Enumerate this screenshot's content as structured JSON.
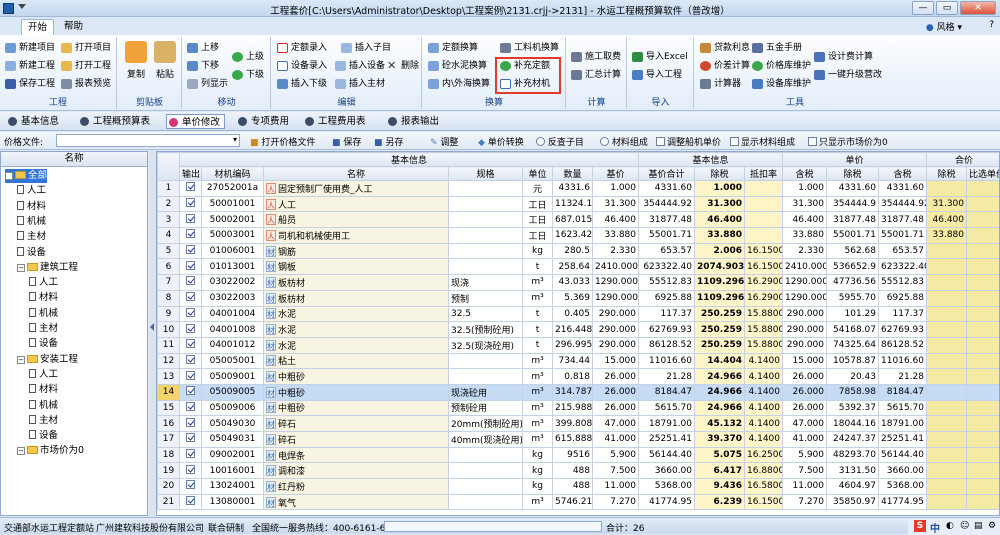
{
  "window": {
    "title": "工程套价[C:\\Users\\Administrator\\Desktop\\工程案例\\2131.crjj->2131] - 水运工程概预算软件（普改增）",
    "min": "—",
    "max": "▭",
    "close": "✕"
  },
  "tabs": [
    "开始",
    "帮助"
  ],
  "skin_label": "风格",
  "ribbon": {
    "groups": [
      {
        "label": "工程",
        "buttons": [
          "新建项目",
          "打开项目",
          "新建工程",
          "打开工程",
          "保存工程",
          "报表预览"
        ]
      },
      {
        "label": "剪贴板",
        "buttons": [
          "复制",
          "粘贴"
        ]
      },
      {
        "label": "移动",
        "buttons": [
          "上移",
          "下移",
          "列显示",
          "上级",
          "下级"
        ]
      },
      {
        "label": "编辑",
        "buttons": [
          "定额录入",
          "插入子目",
          "设备录入",
          "插入设备",
          "删除",
          "插入下级",
          "插入主材"
        ]
      },
      {
        "label": "换算",
        "buttons": [
          "定额换算",
          "工料机换算",
          "砼水泥换算",
          "补充定额",
          "内\\外海换算",
          "补充材机"
        ]
      },
      {
        "label": "计算",
        "buttons": [
          "施工取费",
          "汇总计算"
        ]
      },
      {
        "label": "导入",
        "buttons": [
          "导入Excel",
          "导入工程"
        ]
      },
      {
        "label": "工具",
        "buttons": [
          "贷款利息",
          "五金手册",
          "设计费计算",
          "价差计算",
          "价格库维护",
          "一键升级营改",
          "计算器",
          "设备库维护"
        ]
      }
    ]
  },
  "secondary_tabs": [
    "基本信息",
    "工程概预算表",
    "单价修改",
    "专项费用",
    "工程费用表",
    "报表输出"
  ],
  "toolbar": {
    "price_file_label": "价格文件:",
    "open_price": "打开价格文件",
    "save": "保存",
    "save_as": "另存",
    "adjust": "调整",
    "price_convert": "单价转换",
    "reverse_check": "反查子目",
    "material_comp": "材料组成",
    "adjust_ship": "调整船机单价",
    "show_material": "显示材料组成",
    "show_market": "只显示市场价为0"
  },
  "tree": {
    "header": "名称",
    "nodes": [
      {
        "label": "全部",
        "level": 0,
        "type": "folder",
        "selected": true
      },
      {
        "label": "人工",
        "level": 1,
        "type": "doc"
      },
      {
        "label": "材料",
        "level": 1,
        "type": "doc"
      },
      {
        "label": "机械",
        "level": 1,
        "type": "doc"
      },
      {
        "label": "主材",
        "level": 1,
        "type": "doc"
      },
      {
        "label": "设备",
        "level": 1,
        "type": "doc"
      },
      {
        "label": "建筑工程",
        "level": 1,
        "type": "folder"
      },
      {
        "label": "人工",
        "level": 2,
        "type": "doc"
      },
      {
        "label": "材料",
        "level": 2,
        "type": "doc"
      },
      {
        "label": "机械",
        "level": 2,
        "type": "doc"
      },
      {
        "label": "主材",
        "level": 2,
        "type": "doc"
      },
      {
        "label": "设备",
        "level": 2,
        "type": "doc"
      },
      {
        "label": "安装工程",
        "level": 1,
        "type": "folder"
      },
      {
        "label": "人工",
        "level": 2,
        "type": "doc"
      },
      {
        "label": "材料",
        "level": 2,
        "type": "doc"
      },
      {
        "label": "机械",
        "level": 2,
        "type": "doc"
      },
      {
        "label": "主材",
        "level": 2,
        "type": "doc"
      },
      {
        "label": "设备",
        "level": 2,
        "type": "doc"
      },
      {
        "label": "市场价为0",
        "level": 1,
        "type": "folder"
      }
    ]
  },
  "grid": {
    "group_headers": {
      "base": "基本信息",
      "unit_price": "单价",
      "total": "合价",
      "compare": "比选单价"
    },
    "columns": [
      "输出",
      "材机编码",
      "名称",
      "规格",
      "单位",
      "数量",
      "基价",
      "基价合计",
      "除税",
      "抵扣率",
      "含税",
      "除税",
      "含税",
      "除税"
    ],
    "rows": [
      {
        "n": "1",
        "code": "27052001a",
        "tag": "人",
        "name": "固定预制厂使用费_人工",
        "spec": "",
        "unit": "元",
        "qty": "4331.6",
        "base": "1.000",
        "base_total": "4331.60",
        "ex": "1.000",
        "rate": "",
        "inc": "1.000",
        "t_ex": "4331.60",
        "t_inc": "4331.60",
        "cmp": ""
      },
      {
        "n": "2",
        "code": "50001001",
        "tag": "人",
        "name": "人工",
        "spec": "",
        "unit": "工日",
        "qty": "11324.11",
        "base": "31.300",
        "base_total": "354444.92",
        "ex": "31.300",
        "rate": "",
        "inc": "31.300",
        "t_ex": "354444.9",
        "t_inc": "354444.92",
        "cmp": "31.300"
      },
      {
        "n": "3",
        "code": "50002001",
        "tag": "人",
        "name": "船员",
        "spec": "",
        "unit": "工日",
        "qty": "687.015",
        "base": "46.400",
        "base_total": "31877.48",
        "ex": "46.400",
        "rate": "",
        "inc": "46.400",
        "t_ex": "31877.48",
        "t_inc": "31877.48",
        "cmp": "46.400"
      },
      {
        "n": "4",
        "code": "50003001",
        "tag": "人",
        "name": "司机和机械使用工",
        "spec": "",
        "unit": "工日",
        "qty": "1623.427",
        "base": "33.880",
        "base_total": "55001.71",
        "ex": "33.880",
        "rate": "",
        "inc": "33.880",
        "t_ex": "55001.71",
        "t_inc": "55001.71",
        "cmp": "33.880"
      },
      {
        "n": "5",
        "code": "01006001",
        "tag": "材",
        "name": "钢筋",
        "spec": "",
        "unit": "kg",
        "qty": "280.5",
        "base": "2.330",
        "base_total": "653.57",
        "ex": "2.006",
        "rate": "16.1500",
        "inc": "2.330",
        "t_ex": "562.68",
        "t_inc": "653.57",
        "cmp": ""
      },
      {
        "n": "6",
        "code": "01013001",
        "tag": "材",
        "name": "钢板",
        "spec": "",
        "unit": "t",
        "qty": "258.64",
        "base": "2410.000",
        "base_total": "623322.40",
        "ex": "2074.903",
        "rate": "16.1500",
        "inc": "2410.000",
        "t_ex": "536652.9",
        "t_inc": "623322.40",
        "cmp": ""
      },
      {
        "n": "7",
        "code": "03022002",
        "tag": "材",
        "name": "板枋材",
        "spec": "现浇",
        "unit": "m³",
        "qty": "43.033",
        "base": "1290.000",
        "base_total": "55512.83",
        "ex": "1109.296",
        "rate": "16.2900",
        "inc": "1290.000",
        "t_ex": "47736.56",
        "t_inc": "55512.83",
        "cmp": ""
      },
      {
        "n": "8",
        "code": "03022003",
        "tag": "材",
        "name": "板枋材",
        "spec": "预制",
        "unit": "m³",
        "qty": "5.369",
        "base": "1290.000",
        "base_total": "6925.88",
        "ex": "1109.296",
        "rate": "16.2900",
        "inc": "1290.000",
        "t_ex": "5955.70",
        "t_inc": "6925.88",
        "cmp": ""
      },
      {
        "n": "9",
        "code": "04001004",
        "tag": "材",
        "name": "水泥",
        "spec": "32.5",
        "unit": "t",
        "qty": "0.405",
        "base": "290.000",
        "base_total": "117.37",
        "ex": "250.259",
        "rate": "15.8800",
        "inc": "290.000",
        "t_ex": "101.29",
        "t_inc": "117.37",
        "cmp": ""
      },
      {
        "n": "10",
        "code": "04001008",
        "tag": "材",
        "name": "水泥",
        "spec": "32.5(预制砼用)",
        "unit": "t",
        "qty": "216.448",
        "base": "290.000",
        "base_total": "62769.93",
        "ex": "250.259",
        "rate": "15.8800",
        "inc": "290.000",
        "t_ex": "54168.07",
        "t_inc": "62769.93",
        "cmp": ""
      },
      {
        "n": "11",
        "code": "04001012",
        "tag": "材",
        "name": "水泥",
        "spec": "32.5(现浇砼用)",
        "unit": "t",
        "qty": "296.995",
        "base": "290.000",
        "base_total": "86128.52",
        "ex": "250.259",
        "rate": "15.8800",
        "inc": "290.000",
        "t_ex": "74325.64",
        "t_inc": "86128.52",
        "cmp": ""
      },
      {
        "n": "12",
        "code": "05005001",
        "tag": "材",
        "name": "粘土",
        "spec": "",
        "unit": "m³",
        "qty": "734.44",
        "base": "15.000",
        "base_total": "11016.60",
        "ex": "14.404",
        "rate": "4.1400",
        "inc": "15.000",
        "t_ex": "10578.87",
        "t_inc": "11016.60",
        "cmp": ""
      },
      {
        "n": "13",
        "code": "05009001",
        "tag": "材",
        "name": "中粗砂",
        "spec": "",
        "unit": "m³",
        "qty": "0.818",
        "base": "26.000",
        "base_total": "21.28",
        "ex": "24.966",
        "rate": "4.1400",
        "inc": "26.000",
        "t_ex": "20.43",
        "t_inc": "21.28",
        "cmp": ""
      },
      {
        "n": "14",
        "code": "05009005",
        "tag": "材",
        "name": "中粗砂",
        "spec": "现浇砼用",
        "unit": "m³",
        "qty": "314.787",
        "base": "26.000",
        "base_total": "8184.47",
        "ex": "24.966",
        "rate": "4.1400",
        "inc": "26.000",
        "t_ex": "7858.98",
        "t_inc": "8184.47",
        "cmp": "",
        "sel": true
      },
      {
        "n": "15",
        "code": "05009006",
        "tag": "材",
        "name": "中粗砂",
        "spec": "预制砼用",
        "unit": "m³",
        "qty": "215.988",
        "base": "26.000",
        "base_total": "5615.70",
        "ex": "24.966",
        "rate": "4.1400",
        "inc": "26.000",
        "t_ex": "5392.37",
        "t_inc": "5615.70",
        "cmp": ""
      },
      {
        "n": "16",
        "code": "05049030",
        "tag": "材",
        "name": "碎石",
        "spec": "20mm(预制砼用)",
        "unit": "m³",
        "qty": "399.808",
        "base": "47.000",
        "base_total": "18791.00",
        "ex": "45.132",
        "rate": "4.1400",
        "inc": "47.000",
        "t_ex": "18044.16",
        "t_inc": "18791.00",
        "cmp": ""
      },
      {
        "n": "17",
        "code": "05049031",
        "tag": "材",
        "name": "碎石",
        "spec": "40mm(现浇砼用)",
        "unit": "m³",
        "qty": "615.888",
        "base": "41.000",
        "base_total": "25251.41",
        "ex": "39.370",
        "rate": "4.1400",
        "inc": "41.000",
        "t_ex": "24247.37",
        "t_inc": "25251.41",
        "cmp": ""
      },
      {
        "n": "18",
        "code": "09002001",
        "tag": "材",
        "name": "电焊条",
        "spec": "",
        "unit": "kg",
        "qty": "9516",
        "base": "5.900",
        "base_total": "56144.40",
        "ex": "5.075",
        "rate": "16.2500",
        "inc": "5.900",
        "t_ex": "48293.70",
        "t_inc": "56144.40",
        "cmp": ""
      },
      {
        "n": "19",
        "code": "10016001",
        "tag": "材",
        "name": "调和漆",
        "spec": "",
        "unit": "kg",
        "qty": "488",
        "base": "7.500",
        "base_total": "3660.00",
        "ex": "6.417",
        "rate": "16.8800",
        "inc": "7.500",
        "t_ex": "3131.50",
        "t_inc": "3660.00",
        "cmp": ""
      },
      {
        "n": "20",
        "code": "13024001",
        "tag": "材",
        "name": "红丹粉",
        "spec": "",
        "unit": "kg",
        "qty": "488",
        "base": "11.000",
        "base_total": "5368.00",
        "ex": "9.436",
        "rate": "16.5800",
        "inc": "11.000",
        "t_ex": "4604.97",
        "t_inc": "5368.00",
        "cmp": ""
      },
      {
        "n": "21",
        "code": "13080001",
        "tag": "材",
        "name": "氧气",
        "spec": "",
        "unit": "m³",
        "qty": "5746.21",
        "base": "7.270",
        "base_total": "41774.95",
        "ex": "6.239",
        "rate": "16.1500",
        "inc": "7.270",
        "t_ex": "35850.97",
        "t_inc": "41774.95",
        "cmp": ""
      }
    ]
  },
  "status": {
    "org": "交通部水运工程定额站",
    "company": "广州建软科技股份有限公司",
    "joint": "联合研制",
    "hotline": "全国统一服务热线：400-6161-628",
    "total": "合计：26"
  },
  "tray": {
    "ime": "中",
    "ime_mode": "S"
  }
}
